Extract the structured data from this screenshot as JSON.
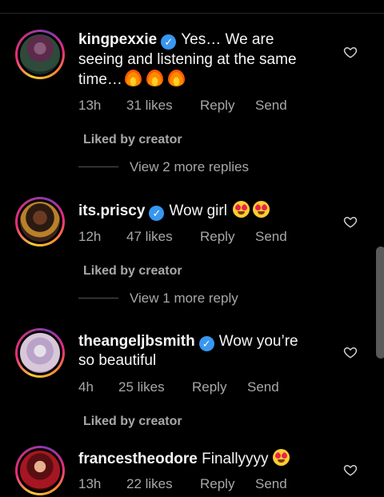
{
  "comments": [
    {
      "username": "kingpexxie",
      "lines": [
        "Yes… We are",
        "seeing and listening at the same",
        "time…"
      ],
      "emoji": [
        "fire-emoji",
        "fire-emoji",
        "fire-emoji"
      ],
      "time": "13h",
      "likes": "31 likes",
      "reply": "Reply",
      "send": "Send",
      "liked_by": "Liked by creator",
      "view_replies": "View 2 more replies"
    },
    {
      "username": "its.priscy",
      "lines": [
        "Wow girl"
      ],
      "emoji": [
        "heart-eyes-emoji",
        "heart-eyes-emoji"
      ],
      "time": "12h",
      "likes": "47 likes",
      "reply": "Reply",
      "send": "Send",
      "liked_by": "Liked by creator",
      "view_replies": "View 1 more reply"
    },
    {
      "username": "theangeljbsmith",
      "lines": [
        "Wow you’re",
        "so beautiful"
      ],
      "emoji": [],
      "time": "4h",
      "likes": "25 likes",
      "reply": "Reply",
      "send": "Send",
      "liked_by": "Liked by creator"
    },
    {
      "username": "francestheodore",
      "lines": [
        "Finallyyyy"
      ],
      "emoji": [
        "heart-eyes-emoji"
      ],
      "time": "13h",
      "likes": "22 likes",
      "reply": "Reply",
      "send": "Send"
    }
  ],
  "colors": {
    "background": "#000000",
    "text": "#f5f5f5",
    "secondary_text": "#a8a8a8",
    "verified": "#3897f0"
  }
}
